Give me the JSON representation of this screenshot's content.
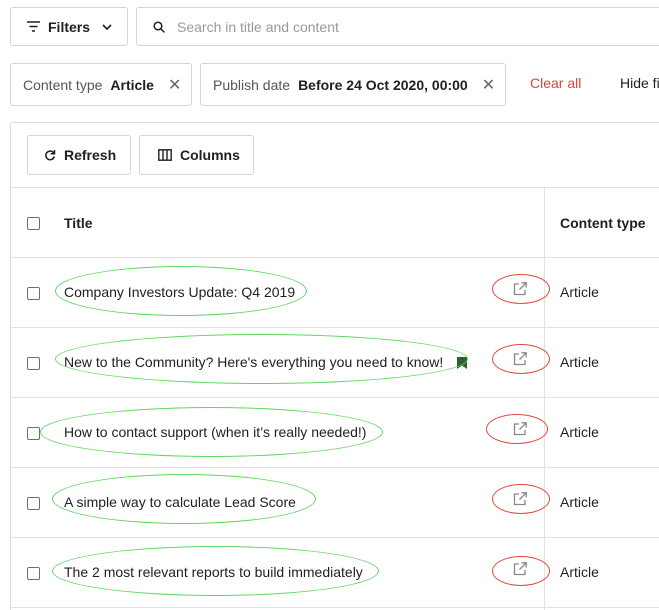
{
  "toolbar": {
    "filters_label": "Filters",
    "search_placeholder": "Search in title and content"
  },
  "filter_chips": [
    {
      "label": "Content type",
      "value": "Article"
    },
    {
      "label": "Publish date",
      "value": "Before 24 Oct 2020, 00:00"
    }
  ],
  "clear_all_label": "Clear all",
  "hide_filters_label": "Hide fi",
  "table_toolbar": {
    "refresh_label": "Refresh",
    "columns_label": "Columns"
  },
  "table": {
    "headers": {
      "title": "Title",
      "content_type": "Content type"
    },
    "rows": [
      {
        "title": "Company Investors Update: Q4 2019",
        "type": "Article"
      },
      {
        "title": "New to the Community? Here's everything you need to know!",
        "type": "Article"
      },
      {
        "title": "How to contact support (when it’s really needed!)",
        "type": "Article"
      },
      {
        "title": "A simple way to calculate Lead Score",
        "type": "Article"
      },
      {
        "title": "The 2 most relevant reports to build immediately",
        "type": "Article"
      }
    ]
  },
  "colors": {
    "clear_all": "#d9463a",
    "green_annotation": "#5fd65f",
    "red_annotation": "#e04a3f"
  },
  "icons": [
    "filter-icon",
    "chevron-down-icon",
    "search-icon",
    "close-icon",
    "refresh-icon",
    "columns-icon",
    "external-link-icon",
    "flag-icon"
  ]
}
